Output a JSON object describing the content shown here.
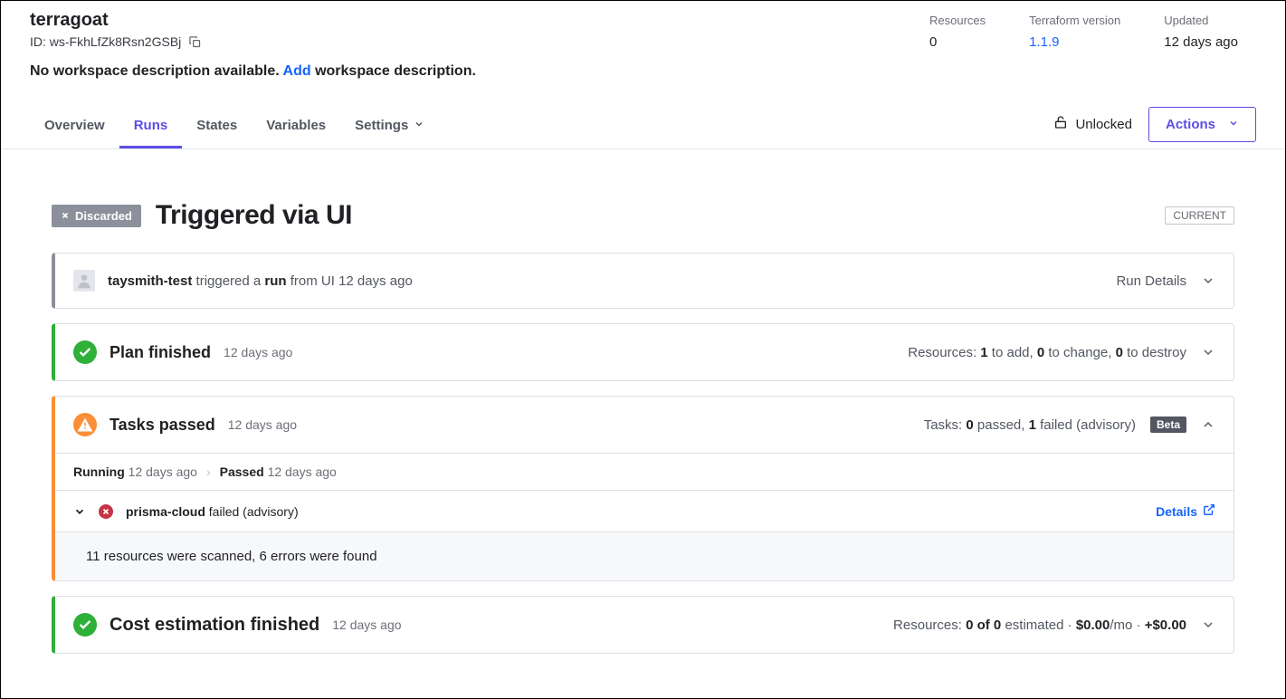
{
  "workspace": {
    "name": "terragoat",
    "id_label": "ID: ws-FkhLfZk8Rsn2GSBj",
    "description_prefix": "No workspace description available.",
    "add_text": "Add",
    "description_suffix": "workspace description."
  },
  "meta": {
    "resources_label": "Resources",
    "resources_value": "0",
    "tf_version_label": "Terraform version",
    "tf_version_value": "1.1.9",
    "updated_label": "Updated",
    "updated_value": "12 days ago"
  },
  "tabs": {
    "overview": "Overview",
    "runs": "Runs",
    "states": "States",
    "variables": "Variables",
    "settings": "Settings"
  },
  "toolbar": {
    "unlocked": "Unlocked",
    "actions": "Actions"
  },
  "run": {
    "discarded": "Discarded",
    "title": "Triggered via UI",
    "current": "CURRENT"
  },
  "trigger": {
    "user": "taysmith-test",
    "t1": " triggered a ",
    "t2": "run",
    "t3": " from UI 12 days ago",
    "run_details": "Run Details"
  },
  "plan": {
    "title": "Plan finished",
    "time": "12 days ago",
    "res_label": "Resources: ",
    "add_n": "1",
    "add_t": " to add, ",
    "change_n": "0",
    "change_t": " to change, ",
    "destroy_n": "0",
    "destroy_t": " to destroy"
  },
  "tasks": {
    "title": "Tasks passed",
    "time": "12 days ago",
    "summary_pre": "Tasks: ",
    "passed_n": "0",
    "passed_t": " passed, ",
    "failed_n": "1",
    "failed_t": " failed (advisory)",
    "beta": "Beta",
    "running_label": "Running ",
    "running_time": "12 days ago",
    "passed_label": "Passed ",
    "passed_time": "12 days ago",
    "task_name": "prisma-cloud",
    "task_status": " failed (advisory)",
    "details": "Details",
    "message": "11 resources were scanned, 6 errors were found"
  },
  "cost": {
    "title": "Cost estimation finished",
    "time": "12 days ago",
    "res_pre": "Resources: ",
    "res_n": "0 of 0",
    "res_t": " estimated · ",
    "mo": "$0.00",
    "mo_t": "/mo · ",
    "delta": "+$0.00"
  }
}
